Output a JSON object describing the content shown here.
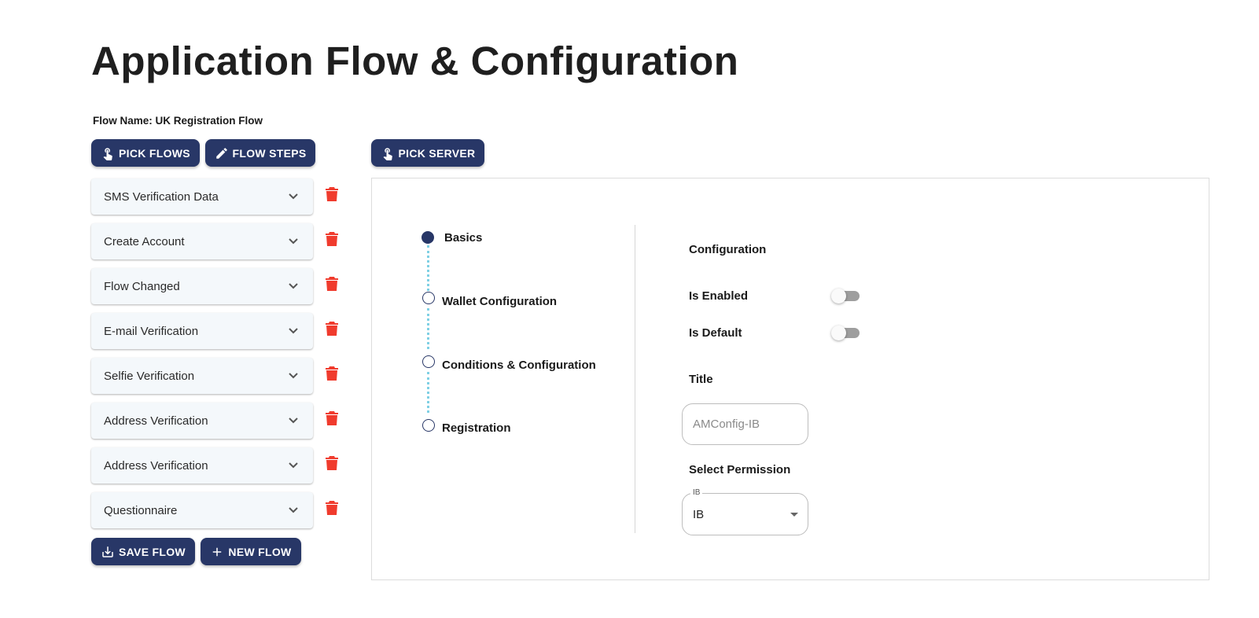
{
  "page": {
    "title": "Application Flow & Configuration",
    "flow_name": "Flow Name: UK Registration Flow"
  },
  "toolbar": {
    "pick_flows": "PICK FLOWS",
    "flow_steps": "FLOW STEPS",
    "pick_server": "PICK SERVER",
    "save_flow": "SAVE FLOW",
    "new_flow": "NEW FLOW"
  },
  "steps": [
    {
      "label": "SMS Verification Data"
    },
    {
      "label": "Create Account"
    },
    {
      "label": "Flow Changed"
    },
    {
      "label": "E-mail Verification"
    },
    {
      "label": "Selfie Verification"
    },
    {
      "label": "Address Verification"
    },
    {
      "label": "Address Verification"
    },
    {
      "label": "Questionnaire"
    }
  ],
  "stepper": {
    "items": [
      {
        "label": "Basics",
        "active": true
      },
      {
        "label": "Wallet Configuration",
        "active": false
      },
      {
        "label": "Conditions & Configuration",
        "active": false
      },
      {
        "label": "Registration",
        "active": false
      }
    ]
  },
  "config": {
    "heading": "Configuration",
    "is_enabled_label": "Is Enabled",
    "is_enabled": false,
    "is_default_label": "Is Default",
    "is_default": false,
    "title_label": "Title",
    "title_placeholder": "AMConfig-IB",
    "permission_label": "Select Permission",
    "permission_legend": "IB",
    "permission_value": "IB"
  },
  "colors": {
    "primary": "#283767",
    "danger": "#f03b2d",
    "stepper_line": "#7fd0e4",
    "card_bg": "#f4f8fb"
  }
}
